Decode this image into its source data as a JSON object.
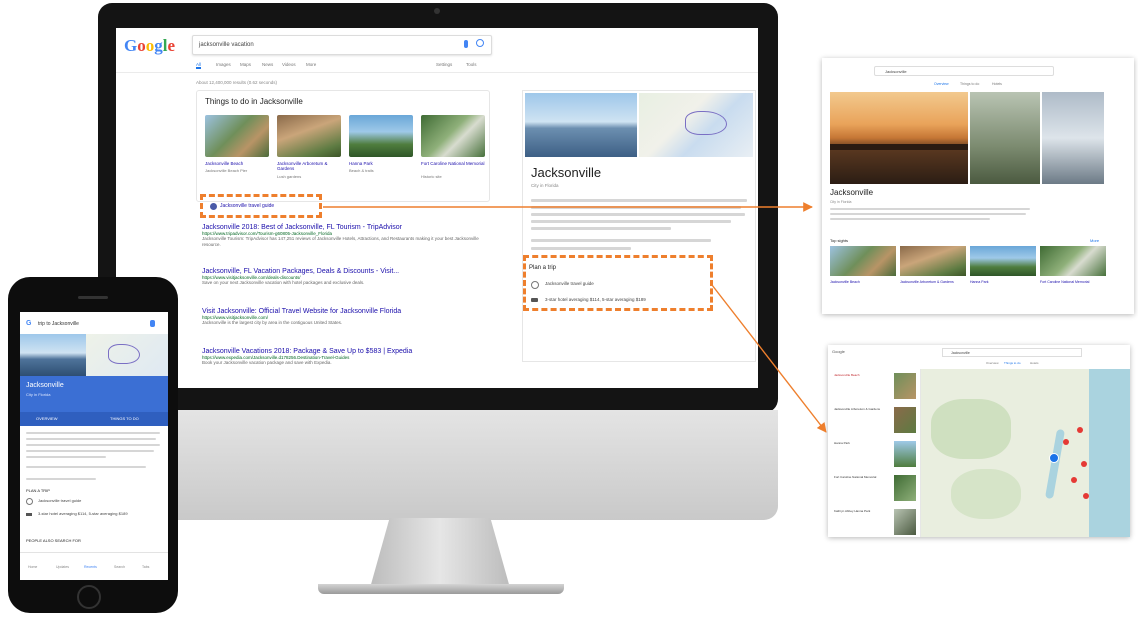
{
  "search": {
    "logo_letters": [
      "G",
      "o",
      "o",
      "g",
      "l",
      "e"
    ],
    "query": "jacksonville vacation"
  },
  "tabs": [
    "All",
    "Images",
    "Maps",
    "News",
    "Videos",
    "More"
  ],
  "right_tabs": [
    "Settings",
    "Tools"
  ],
  "result_stats": "About 12,400,000 results (0.62 seconds)",
  "things_to_do": {
    "heading": "Things to do in Jacksonville",
    "items": [
      {
        "title": "Jacksonville Beach",
        "sub": "Jacksonville Beach Pier"
      },
      {
        "title": "Jacksonville Arboretum & Gardens",
        "sub": "Lush gardens"
      },
      {
        "title": "Hanna Park",
        "sub": "Beach & trails"
      },
      {
        "title": "Fort Caroline National Memorial",
        "sub": "Historic site"
      }
    ]
  },
  "highlight_link": "Jacksonville travel guide",
  "results": [
    {
      "title": "Jacksonville 2018: Best of Jacksonville, FL Tourism - TripAdvisor",
      "url": "https://www.tripadvisor.com/Tourism-g60805-Jacksonville_Florida",
      "snippet": "Jacksonville Tourism: TripAdvisor has 147,251 reviews of Jacksonville Hotels, Attractions, and Restaurants making it your best Jacksonville resource."
    },
    {
      "title": "Jacksonville, FL Vacation Packages, Deals & Discounts - Visit...",
      "url": "https://www.visitjacksonville.com/deals-discounts/",
      "snippet": "Save on your next Jacksonville vacation with hotel packages and exclusive deals."
    },
    {
      "title": "Visit Jacksonville: Official Travel Website for Jacksonville Florida",
      "url": "https://www.visitjacksonville.com/",
      "snippet": "Jacksonville is the largest city by area in the contiguous United States."
    },
    {
      "title": "Jacksonville Vacations 2018: Package & Save Up to $583 | Expedia",
      "url": "https://www.expedia.com/Jacksonville.d178256.Destination-Travel-Guides",
      "snippet": "Book your Jacksonville vacation package and save with Expedia."
    }
  ],
  "knowledge_panel": {
    "title": "Jacksonville",
    "subtitle": "City in Florida",
    "plan_heading": "Plan a trip",
    "plan_items": [
      "Jacksonville travel guide",
      "3-star hotel averaging $114, 5-star averaging $189"
    ]
  },
  "phone": {
    "query": "trip to Jacksonville",
    "card_title": "Jacksonville",
    "card_sub": "City in Florida",
    "btn_left": "OVERVIEW",
    "btn_right": "THINGS TO DO",
    "plan_heading": "PLAN A TRIP",
    "plan_items": [
      "Jacksonville travel guide",
      "3-star hotel averaging $114, 5-star averaging $189"
    ],
    "people_heading": "PEOPLE ALSO SEARCH FOR",
    "nav": [
      "Home",
      "Updates",
      "Recents",
      "Search",
      "Tabs"
    ]
  },
  "panel_top": {
    "query": "Jacksonville",
    "tabs": [
      "Overview",
      "Things to do",
      "Hotels"
    ],
    "title": "Jacksonville",
    "subtitle": "City in Florida",
    "section": "Top sights",
    "more": "More",
    "sights": [
      "Jacksonville Beach",
      "Jacksonville Arboretum & Gardens",
      "Hanna Park",
      "Fort Caroline National Memorial"
    ]
  },
  "panel_bottom": {
    "logo": "Google",
    "query": "Jacksonville",
    "tabs": [
      "Overview",
      "Things to do",
      "Hotels"
    ],
    "list": [
      "Jacksonville Beach",
      "Jacksonville Arboretum & Gardens",
      "Hanna Park",
      "Fort Caroline National Memorial",
      "Kathryn Abbey Hanna Park"
    ]
  },
  "colors": {
    "accent": "#ee7f2d",
    "google_blue": "#4285f4",
    "link": "#1a0dab",
    "url_green": "#006621"
  }
}
